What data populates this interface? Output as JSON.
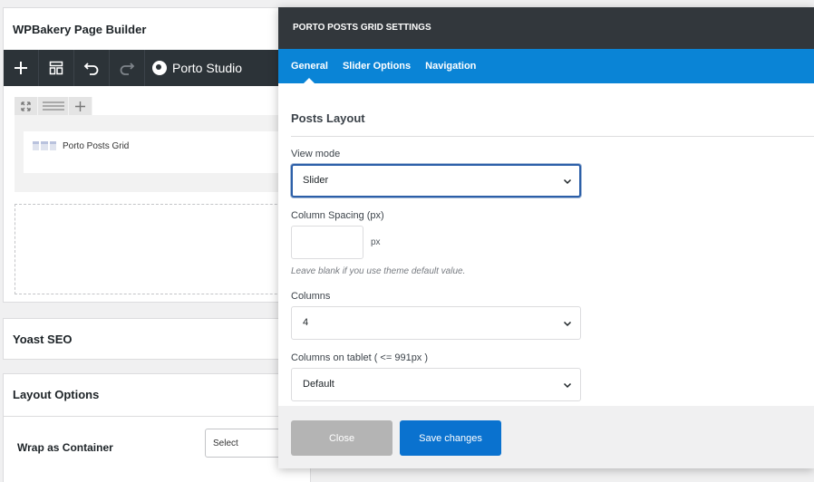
{
  "builder": {
    "title": "WPBakery Page Builder",
    "toolbar": {
      "studio_label": "Porto Studio"
    },
    "element_label": "Porto Posts Grid"
  },
  "yoast": {
    "title": "Yoast SEO"
  },
  "layout_options": {
    "title": "Layout Options",
    "wrap_label": "Wrap as Container",
    "wrap_select_value": "Select"
  },
  "modal": {
    "title": "PORTO POSTS GRID SETTINGS",
    "tabs": [
      {
        "label": "General",
        "active": true
      },
      {
        "label": "Slider Options",
        "active": false
      },
      {
        "label": "Navigation",
        "active": false
      }
    ],
    "section_title": "Posts Layout",
    "view_mode": {
      "label": "View mode",
      "value": "Slider"
    },
    "column_spacing": {
      "label": "Column Spacing (px)",
      "value": "",
      "unit": "px",
      "hint": "Leave blank if you use theme default value."
    },
    "columns": {
      "label": "Columns",
      "value": "4"
    },
    "columns_tablet": {
      "label": "Columns on tablet ( <= 991px )",
      "value": "Default"
    },
    "footer": {
      "close_label": "Close",
      "save_label": "Save changes"
    }
  },
  "colors": {
    "header_bg": "#32373c",
    "tabs_bg": "#0a84d6",
    "save_button": "#0a72cf",
    "close_button": "#b4b4b4",
    "toolbar_bg": "#2c3338"
  }
}
